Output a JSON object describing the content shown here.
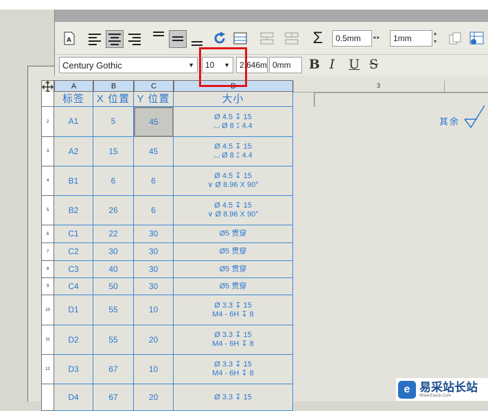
{
  "toolbar": {
    "line_weight": "0.5mm",
    "spacing": "1mm",
    "font_name": "Century Gothic",
    "font_size": "10",
    "height_value": "2.646m",
    "offset_value": "0mm",
    "bold": "B",
    "italic": "I",
    "underline": "U",
    "strike": "S",
    "sigma": "Σ"
  },
  "table": {
    "col_headers": [
      "A",
      "B",
      "C",
      "D"
    ],
    "header_row": [
      "标签",
      "X 位置",
      "Y 位置",
      "大小"
    ],
    "row_numbers": [
      "",
      "2",
      "3",
      "4",
      "5",
      "6",
      "7",
      "8",
      "9",
      "10",
      "11",
      "12",
      ""
    ],
    "rows": [
      {
        "tag": "A1",
        "x": "5",
        "y": "45",
        "size1": "Ø 4.5 ↧ 15",
        "size2": "⌴ Ø 8 ↧ 4.4"
      },
      {
        "tag": "A2",
        "x": "15",
        "y": "45",
        "size1": "Ø 4.5 ↧ 15",
        "size2": "⌴ Ø 8 ↧ 4.4"
      },
      {
        "tag": "B1",
        "x": "6",
        "y": "6",
        "size1": "Ø 4.5 ↧ 15",
        "size2": "∨ Ø 8.96 X 90°"
      },
      {
        "tag": "B2",
        "x": "26",
        "y": "6",
        "size1": "Ø 4.5 ↧ 15",
        "size2": "∨ Ø 8.96 X 90°"
      },
      {
        "tag": "C1",
        "x": "22",
        "y": "30",
        "size1": "Ø5 贯穿",
        "size2": ""
      },
      {
        "tag": "C2",
        "x": "30",
        "y": "30",
        "size1": "Ø5 贯穿",
        "size2": ""
      },
      {
        "tag": "C3",
        "x": "40",
        "y": "30",
        "size1": "Ø5 贯穿",
        "size2": ""
      },
      {
        "tag": "C4",
        "x": "50",
        "y": "30",
        "size1": "Ø5 贯穿",
        "size2": ""
      },
      {
        "tag": "D1",
        "x": "55",
        "y": "10",
        "size1": "Ø 3.3 ↧ 15",
        "size2": "M4 - 6H ↧ 8"
      },
      {
        "tag": "D2",
        "x": "55",
        "y": "20",
        "size1": "Ø 3.3 ↧ 15",
        "size2": "M4 - 6H ↧ 8"
      },
      {
        "tag": "D3",
        "x": "67",
        "y": "10",
        "size1": "Ø 3.3 ↧ 15",
        "size2": "M4 - 6H ↧ 8"
      },
      {
        "tag": "D4",
        "x": "67",
        "y": "20",
        "size1": "Ø 3.3 ↧ 15",
        "size2": ""
      }
    ]
  },
  "sheet": {
    "zone_number": "3",
    "note_text": "其余"
  },
  "watermark": {
    "text": "易采站长站",
    "sub": "Www.Easck.Com"
  }
}
